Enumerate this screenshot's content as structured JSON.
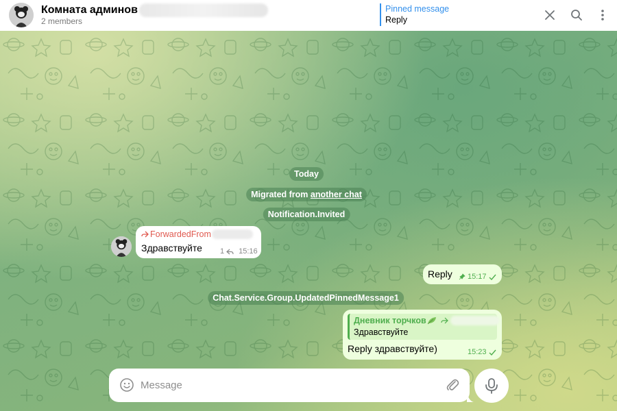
{
  "header": {
    "title": "Комната админов",
    "subtitle": "2 members",
    "pinned_label": "Pinned message",
    "pinned_text": "Reply",
    "icons": [
      "close-icon",
      "search-icon",
      "more-vertical-icon"
    ]
  },
  "service": {
    "date": "Today",
    "migrated_prefix": "Migrated from ",
    "migrated_link": "another chat",
    "invited": "Notification.Invited",
    "pinned_update": "Chat.Service.Group.UpdatedPinnedMessage1"
  },
  "messages": {
    "incoming": {
      "forwarded_label": "ForwardedFrom",
      "text": "Здравствуйте",
      "replies": "1",
      "time": "15:16"
    },
    "out_reply": {
      "text": "Reply",
      "time": "15:17"
    },
    "out_quoted": {
      "quote_author": "Дневник торчков",
      "quote_text": "Здравствуйте",
      "text": "Reply здравствуйте)",
      "time": "15:23"
    }
  },
  "composer": {
    "placeholder": "Message"
  },
  "colors": {
    "accent": "#3390ec",
    "outgoing_bubble": "#eeffde",
    "outgoing_meta": "#4fae4e",
    "forward_label": "#e0594f",
    "service_pill": "#4a8253"
  }
}
